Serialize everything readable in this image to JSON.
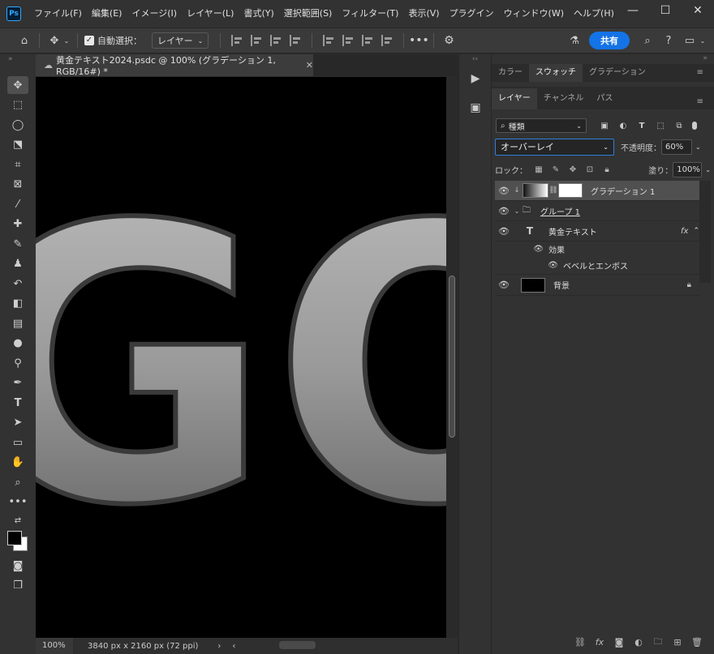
{
  "app": {
    "logo": "Ps"
  },
  "menu": [
    "ファイル(F)",
    "編集(E)",
    "イメージ(I)",
    "レイヤー(L)",
    "書式(Y)",
    "選択範囲(S)",
    "フィルター(T)",
    "表示(V)",
    "プラグイン",
    "ウィンドウ(W)",
    "ヘルプ(H)"
  ],
  "window_controls": {
    "minimize": "—",
    "maximize": "☐",
    "close": "✕"
  },
  "options_bar": {
    "auto_select_label": "自動選択：",
    "auto_select_target": "レイヤー",
    "share_label": "共有"
  },
  "document": {
    "tab_title": "黄金テキスト2024.psdc @ 100% (グラデーション 1, RGB/16#) *",
    "canvas_text": "GO",
    "zoom": "100%",
    "info": "3840 px x 2160 px (72 ppi)"
  },
  "panels": {
    "top_tabs": [
      "カラー",
      "スウォッチ",
      "グラデーション"
    ],
    "top_active": 1,
    "layer_tabs": [
      "レイヤー",
      "チャンネル",
      "パス"
    ],
    "layer_active": 0,
    "filter_kind": "種類",
    "blend_mode": "オーバーレイ",
    "opacity_label": "不透明度：",
    "opacity_value": "60%",
    "lock_label": "ロック：",
    "fill_label": "塗り：",
    "fill_value": "100%"
  },
  "layers": [
    {
      "name": "グラデーション 1",
      "type": "gradient",
      "selected": true
    },
    {
      "name": "グループ 1",
      "type": "group"
    },
    {
      "name": "黄金テキスト",
      "type": "text",
      "fx": "fx"
    },
    {
      "name": "効果",
      "type": "effects"
    },
    {
      "name": "ベベルとエンボス",
      "type": "effect"
    },
    {
      "name": "背景",
      "type": "background"
    }
  ],
  "colors": {
    "accent": "#1473e6",
    "panel": "#323232",
    "canvas": "#000000"
  }
}
